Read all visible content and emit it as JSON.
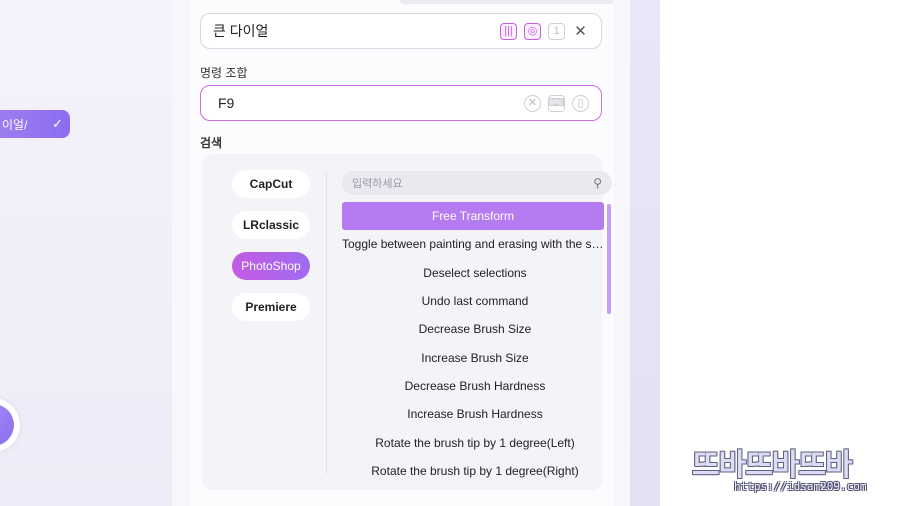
{
  "left": {
    "pill_label": "이얼/",
    "pill_icon": "check-icon"
  },
  "shortcut": {
    "name_value": "큰 다이얼",
    "combo_label": "명령 조합",
    "combo_value": "F9",
    "close_glyph": "✕",
    "name_icon_1": "|||",
    "name_icon_2": "◎",
    "name_icon_3": "1"
  },
  "search": {
    "label": "검색",
    "placeholder": "입력하세요",
    "apps": [
      {
        "label": "CapCut",
        "active": false
      },
      {
        "label": "LRclassic",
        "active": false
      },
      {
        "label": "PhotoShop",
        "active": true
      },
      {
        "label": "Premiere",
        "active": false
      }
    ],
    "results": [
      "Free Transform",
      "Toggle between painting and erasing with the same brush",
      "Deselect selections",
      "Undo last command",
      "Decrease Brush Size",
      "Increase Brush Size",
      "Decrease Brush Hardness",
      "Increase Brush Hardness",
      "Rotate the brush tip by 1 degree(Left)",
      "Rotate the brush tip by 1 degree(Right)"
    ],
    "selected_index": 0
  },
  "watermark": {
    "main": "뜨바뜨바뜨바",
    "url": "https://idsam209.com"
  },
  "colors": {
    "accent": "#b57cf1",
    "accent_pink": "#cf6be6",
    "panel_bg": "#f7f7fb"
  }
}
